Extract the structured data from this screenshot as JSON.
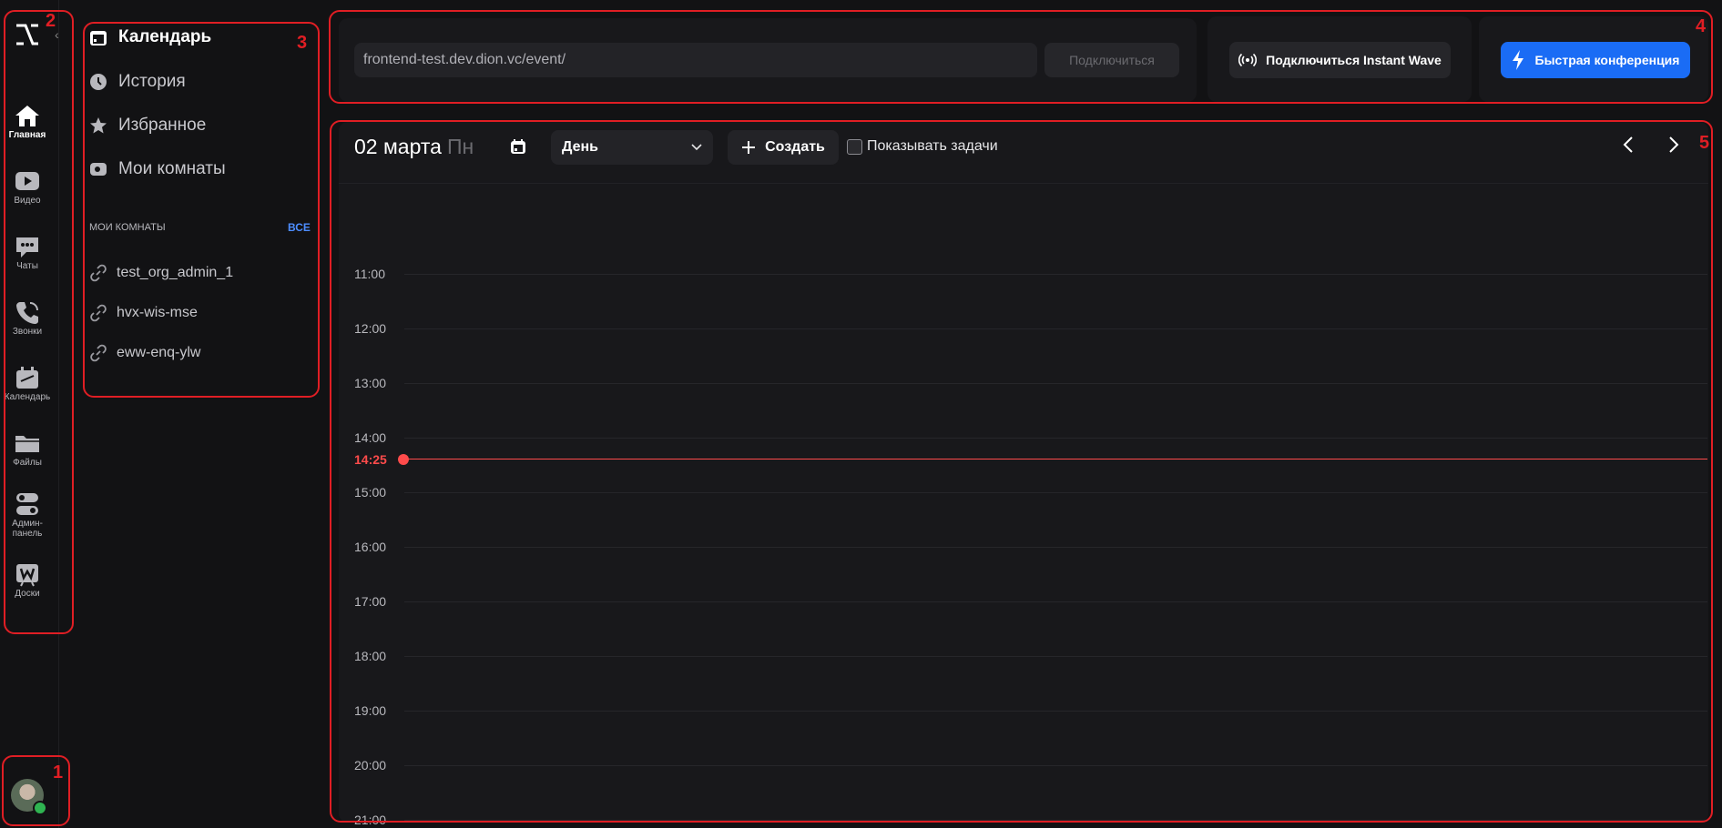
{
  "rail": {
    "items": [
      {
        "label": "Главная",
        "icon": "home-icon"
      },
      {
        "label": "Видео",
        "icon": "video-icon"
      },
      {
        "label": "Чаты",
        "icon": "chat-icon"
      },
      {
        "label": "Звонки",
        "icon": "phone-icon"
      },
      {
        "label": "Календарь",
        "icon": "calendar-icon"
      },
      {
        "label": "Файлы",
        "icon": "folder-icon"
      },
      {
        "label": "Админ-панель",
        "label_line1": "Админ-",
        "label_line2": "панель",
        "icon": "toggle-icon"
      },
      {
        "label": "Доски",
        "icon": "board-icon"
      }
    ]
  },
  "sidebar": {
    "nav": [
      {
        "label": "Календарь",
        "icon": "calendar-icon"
      },
      {
        "label": "История",
        "icon": "clock-icon"
      },
      {
        "label": "Избранное",
        "icon": "star-icon"
      },
      {
        "label": "Мои комнаты",
        "icon": "camera-icon"
      }
    ],
    "rooms_header": "МОИ КОМНАТЫ",
    "rooms_all": "ВСЕ",
    "rooms": [
      "test_org_admin_1",
      "hvx-wis-mse",
      "eww-enq-ylw"
    ]
  },
  "topbar": {
    "url_value": "frontend-test.dev.dion.vc/event/",
    "connect_label": "Подключиться",
    "wave_label": "Подключиться Instant Wave",
    "quick_label": "Быстрая конференция"
  },
  "calendar": {
    "date": "02 марта",
    "weekday": "Пн",
    "view": "День",
    "create_label": "Создать",
    "show_tasks_label": "Показывать задачи",
    "hours": [
      "11:00",
      "12:00",
      "13:00",
      "14:00",
      "15:00",
      "16:00",
      "17:00",
      "18:00",
      "19:00",
      "20:00",
      "21:00"
    ],
    "now_label": "14:25"
  },
  "annotations": [
    "1",
    "2",
    "3",
    "4",
    "5"
  ],
  "colors": {
    "accent": "#1a6cf5",
    "now": "#ff4b4b",
    "annotation": "#e01e24",
    "all_link": "#4d8dff"
  }
}
